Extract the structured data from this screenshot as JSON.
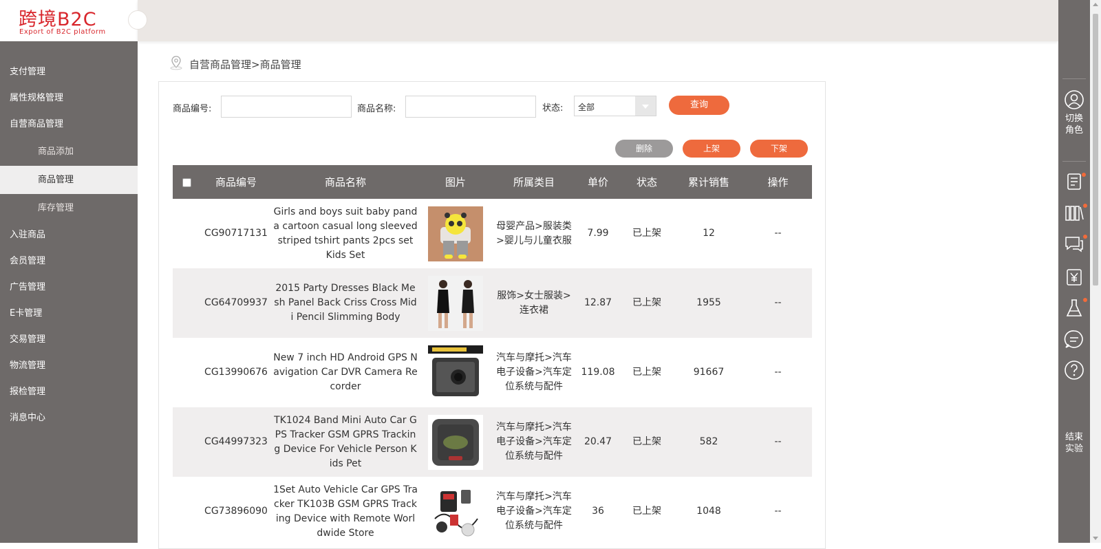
{
  "logo": {
    "main": "跨境B2C",
    "sub": "Export of B2C platform"
  },
  "sidebar": {
    "items": [
      {
        "label": "支付管理",
        "level": 1
      },
      {
        "label": "属性规格管理",
        "level": 1
      },
      {
        "label": "自营商品管理",
        "level": 1
      },
      {
        "label": "商品添加",
        "level": 2
      },
      {
        "label": "商品管理",
        "level": 2,
        "active": true
      },
      {
        "label": "库存管理",
        "level": 2
      },
      {
        "label": "入驻商品",
        "level": 1
      },
      {
        "label": "会员管理",
        "level": 1
      },
      {
        "label": "广告管理",
        "level": 1
      },
      {
        "label": "E卡管理",
        "level": 1
      },
      {
        "label": "交易管理",
        "level": 1
      },
      {
        "label": "物流管理",
        "level": 1
      },
      {
        "label": "报检管理",
        "level": 1
      },
      {
        "label": "消息中心",
        "level": 1
      }
    ]
  },
  "breadcrumb": "自营商品管理>商品管理",
  "search": {
    "code_label": "商品编号:",
    "code_value": "",
    "name_label": "商品名称:",
    "name_value": "",
    "status_label": "状态:",
    "status_value": "全部",
    "query_button": "查询"
  },
  "actions": {
    "delete": "删除",
    "on_shelf": "上架",
    "off_shelf": "下架"
  },
  "table": {
    "headers": [
      "商品编号",
      "商品名称",
      "图片",
      "所属类目",
      "单价",
      "状态",
      "累计销售",
      "操作"
    ],
    "rows": [
      {
        "code": "CG90717131",
        "name": "Girls and boys suit baby panda cartoon casual long sleeved striped tshirt pants 2pcs set Kids Set",
        "category": "母婴产品>服装类>婴儿与儿童衣服",
        "price": "7.99",
        "status": "已上架",
        "sales": "12",
        "op": "--",
        "image": "panda-outfit-image"
      },
      {
        "code": "CG64709937",
        "name": "2015 Party Dresses Black Mesh Panel Back Criss Cross Midi Pencil Slimming Body",
        "category": "服饰>女士服装>连衣裙",
        "price": "12.87",
        "status": "已上架",
        "sales": "1955",
        "op": "--",
        "image": "black-dress-image"
      },
      {
        "code": "CG13990676",
        "name": "New 7 inch HD Android GPS Navigation Car DVR Camera Recorder",
        "category": "汽车与摩托>汽车电子设备>汽车定位系统与配件",
        "price": "119.08",
        "status": "已上架",
        "sales": "91667",
        "op": "--",
        "image": "gps-navigator-image"
      },
      {
        "code": "CG44997323",
        "name": "TK1024 Band Mini Auto Car GPS Tracker GSM GPRS Tracking Device For Vehicle Person Kids Pet",
        "category": "汽车与摩托>汽车电子设备>汽车定位系统与配件",
        "price": "20.47",
        "status": "已上架",
        "sales": "582",
        "op": "--",
        "image": "gps-tracker-image"
      },
      {
        "code": "CG73896090",
        "name": "1Set Auto Vehicle Car GPS Tracker TK103B GSM GPRS Tracking Device with Remote Worldwide Store",
        "category": "汽车与摩托>汽车电子设备>汽车定位系统与配件",
        "price": "36",
        "status": "已上架",
        "sales": "1048",
        "op": "--",
        "image": "gps-kit-image"
      }
    ]
  },
  "rail": {
    "switch_role": "切换角色",
    "end_experiment": "结束实验"
  },
  "colors": {
    "accent": "#ee6a3d",
    "sidebar": "#6e6a69",
    "topbar": "#ebe7e4"
  }
}
